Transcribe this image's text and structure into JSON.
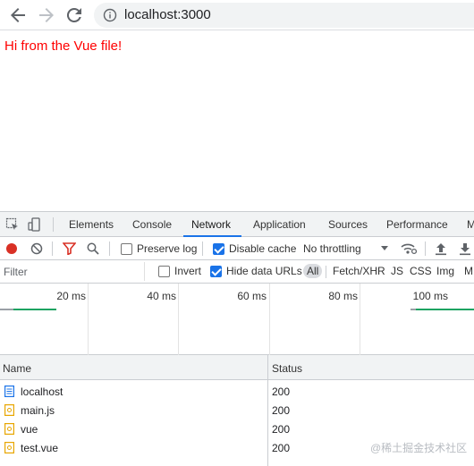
{
  "browser": {
    "url": "localhost:3000"
  },
  "page": {
    "message": "Hi from the Vue file!"
  },
  "devtools": {
    "tabs": [
      "Elements",
      "Console",
      "Network",
      "Application",
      "Sources",
      "Performance",
      "M"
    ],
    "active_tab": "Network",
    "toolbar": {
      "preserve_log": "Preserve log",
      "disable_cache": "Disable cache",
      "throttling": "No throttling"
    },
    "filter": {
      "placeholder": "Filter",
      "invert": "Invert",
      "hide_data_urls": "Hide data URLs",
      "types": [
        "All",
        "Fetch/XHR",
        "JS",
        "CSS",
        "Img",
        "M"
      ]
    },
    "timeline": {
      "labels": [
        "20 ms",
        "40 ms",
        "60 ms",
        "80 ms",
        "100 ms"
      ]
    },
    "table": {
      "headers": {
        "name": "Name",
        "status": "Status"
      },
      "rows": [
        {
          "name": "localhost",
          "status": "200",
          "type": "document"
        },
        {
          "name": "main.js",
          "status": "200",
          "type": "script"
        },
        {
          "name": "vue",
          "status": "200",
          "type": "script"
        },
        {
          "name": "test.vue",
          "status": "200",
          "type": "script"
        }
      ]
    }
  },
  "watermark": "@稀土掘金技术社区",
  "colors": {
    "accent": "#1a73e8",
    "record": "#d93025",
    "message": "#ff0000"
  }
}
